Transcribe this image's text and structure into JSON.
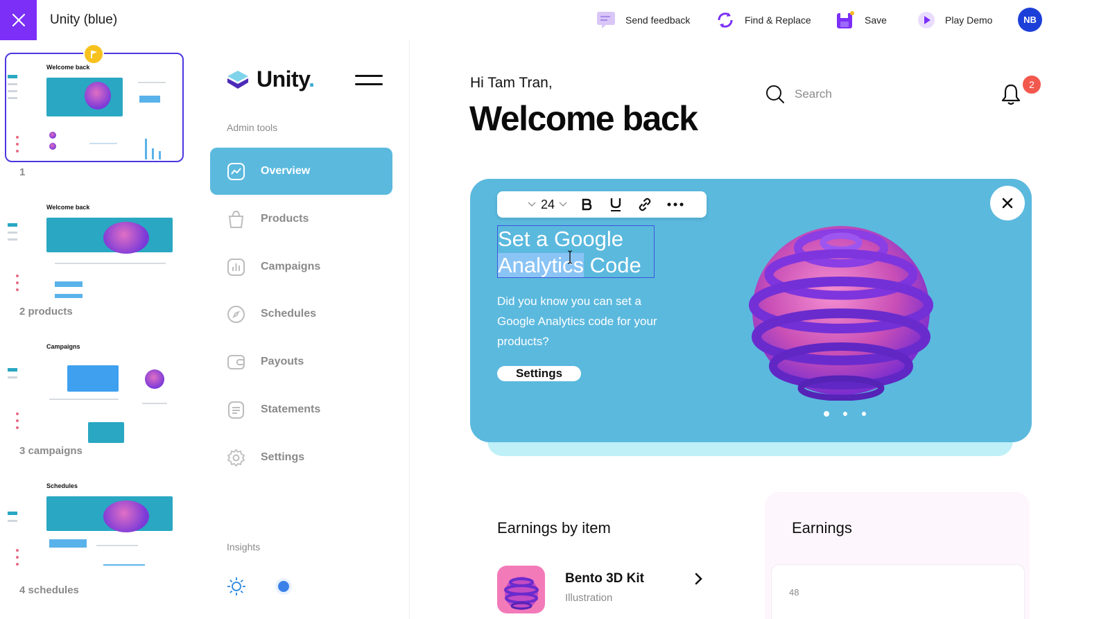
{
  "window": {
    "title": "Unity (blue)",
    "actions": {
      "feedback": "Send feedback",
      "find_replace": "Find & Replace",
      "save": "Save",
      "play": "Play Demo"
    },
    "avatar_initials": "NB"
  },
  "thumbnails": [
    {
      "label": "1",
      "mini_title": "Welcome back"
    },
    {
      "label": "2 products",
      "mini_title": "Welcome back"
    },
    {
      "label": "3 campaigns",
      "mini_title": "Campaigns"
    },
    {
      "label": "4 schedules",
      "mini_title": "Schedules"
    }
  ],
  "sidebar": {
    "logo": "Unity",
    "logo_dot": ".",
    "admin_label": "Admin tools",
    "items": [
      {
        "label": "Overview",
        "icon": "chart-icon"
      },
      {
        "label": "Products",
        "icon": "bag-icon"
      },
      {
        "label": "Campaigns",
        "icon": "bars-icon"
      },
      {
        "label": "Schedules",
        "icon": "compass-icon"
      },
      {
        "label": "Payouts",
        "icon": "wallet-icon"
      },
      {
        "label": "Statements",
        "icon": "document-icon"
      },
      {
        "label": "Settings",
        "icon": "gear-icon"
      }
    ],
    "insights_label": "Insights"
  },
  "main": {
    "greeting": "Hi Tam Tran,",
    "welcome": "Welcome back",
    "search_placeholder": "Search",
    "notification_count": "2",
    "hero": {
      "font_size": "24",
      "heading_part1": "Set a Google",
      "heading_part2_selected": "Analytics",
      "heading_part3": " Code",
      "text": "Did you know you can set a Google Analytics code for your products?",
      "button": "Settings"
    },
    "earnings_by_item": {
      "title": "Earnings by item",
      "item_name": "Bento 3D Kit",
      "item_category": "Illustration"
    },
    "earnings": {
      "title": "Earnings",
      "value": "48"
    }
  },
  "colors": {
    "accent_purple": "#7b2ff7",
    "sidebar_active": "#5bb9de",
    "hero_bg": "#5bb9de",
    "avatar": "#1c3fd8",
    "badge": "#f2584d"
  }
}
